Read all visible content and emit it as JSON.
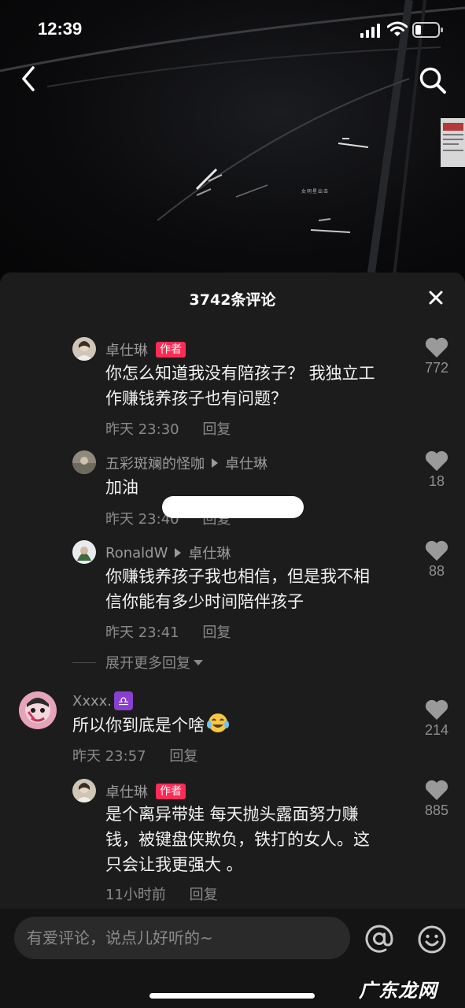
{
  "status_bar": {
    "time": "12:39"
  },
  "video": {
    "watermark_text": "女明星出击"
  },
  "sheet": {
    "title": "3742条评论"
  },
  "comments": [
    {
      "user": "卓仕琳",
      "tag": "作者",
      "text_lines": [
        "你怎么知道我没有陪孩子？ 我独立工",
        "作赚钱养孩子也有问题？"
      ],
      "time": "昨天 23:30",
      "reply_label": "回复",
      "likes": "772"
    },
    {
      "user": "五彩斑斓的怪咖",
      "reply_to": "卓仕琳",
      "text_lines": [
        "加油"
      ],
      "time": "昨天 23:40",
      "reply_label": "回复",
      "likes": "18"
    },
    {
      "user": "RonaldW",
      "reply_to": "卓仕琳",
      "text_lines": [
        "你赚钱养孩子我也相信，但是我不相",
        "信你能有多少时间陪伴孩子"
      ],
      "time": "昨天 23:41",
      "reply_label": "回复",
      "likes": "88"
    },
    {
      "user": "Xxxx.",
      "badge": "♎",
      "text_lines": [
        "所以你到底是个啥"
      ],
      "time": "昨天 23:57",
      "reply_label": "回复",
      "likes": "214"
    },
    {
      "user": "卓仕琳",
      "tag": "作者",
      "text_lines": [
        "是个离异带娃 每天抛头露面努力赚",
        "钱，被键盘侠欺负，铁打的女人。这",
        "只会让我更强大 。"
      ],
      "time": "11小时前",
      "reply_label": "回复",
      "likes": "885"
    }
  ],
  "expand_replies_label": "展开更多回复",
  "input": {
    "placeholder": "有爱评论，说点儿好听的~"
  },
  "watermark": "广东龙网",
  "colors": {
    "sheet_bg": "#1c1c1c",
    "author_tag": "#fe2c55",
    "muted_text": "#8a8a8a"
  }
}
